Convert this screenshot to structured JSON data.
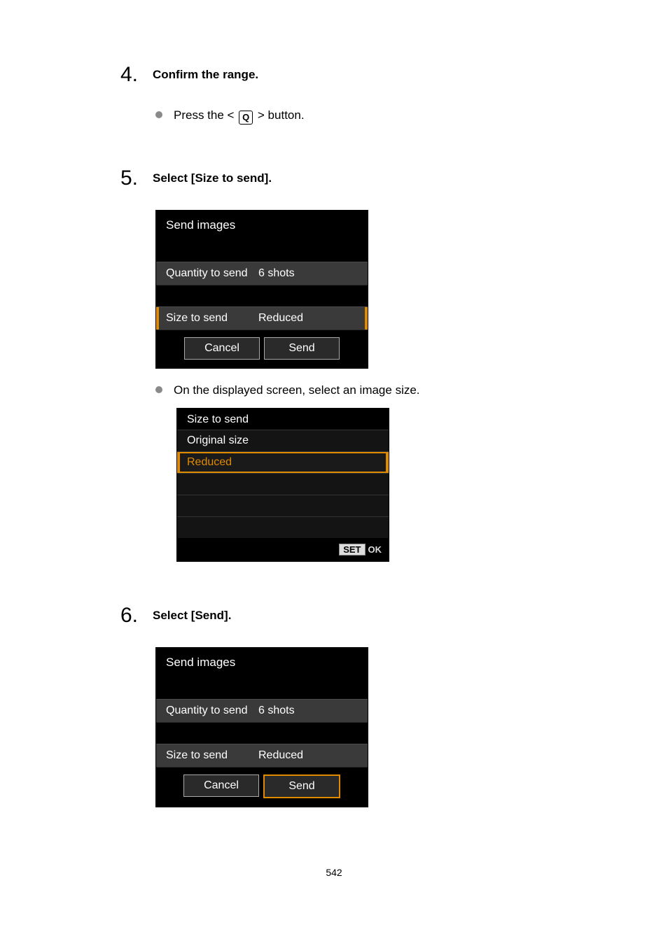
{
  "page_number": "542",
  "steps": [
    {
      "number": "4.",
      "title": "Confirm the range.",
      "bullets": [
        {
          "type": "press_q",
          "pre": "Press the < ",
          "icon": "Q",
          "post": " > button."
        }
      ]
    },
    {
      "number": "5.",
      "title": "Select [Size to send].",
      "screen1": {
        "title": "Send images",
        "quantity_label": "Quantity to send",
        "quantity_value": "6 shots",
        "size_label": "Size to send",
        "size_value": "Reduced",
        "cancel": "Cancel",
        "send": "Send"
      },
      "bullets": [
        {
          "type": "text",
          "text": "On the displayed screen, select an image size."
        }
      ],
      "screen2": {
        "title": "Size to send",
        "option1": "Original size",
        "option2": "Reduced",
        "set_label": "SET",
        "ok_label": "OK"
      }
    },
    {
      "number": "6.",
      "title": "Select [Send].",
      "screen1": {
        "title": "Send images",
        "quantity_label": "Quantity to send",
        "quantity_value": "6 shots",
        "size_label": "Size to send",
        "size_value": "Reduced",
        "cancel": "Cancel",
        "send": "Send"
      }
    }
  ]
}
